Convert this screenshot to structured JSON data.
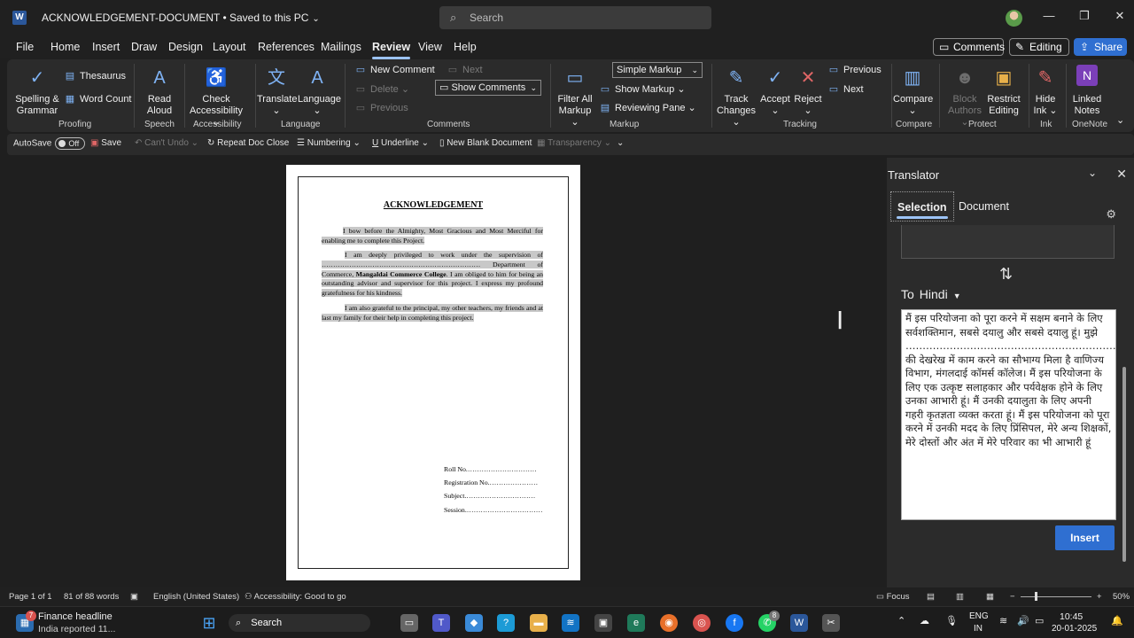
{
  "titlebar": {
    "doc_title": "ACKNOWLEDGEMENT-DOCUMENT • Saved to this PC",
    "search_placeholder": "Search"
  },
  "menu": [
    "File",
    "Home",
    "Insert",
    "Draw",
    "Design",
    "Layout",
    "References",
    "Mailings",
    "Review",
    "View",
    "Help"
  ],
  "menu_active": "Review",
  "top_buttons": {
    "comments": "Comments",
    "editing": "Editing",
    "share": "Share"
  },
  "ribbon": {
    "proofing": {
      "spelling": "Spelling & Grammar",
      "thesaurus": "Thesaurus",
      "word_count": "Word Count",
      "group": "Proofing"
    },
    "speech": {
      "read_aloud": "Read Aloud",
      "group": "Speech"
    },
    "accessibility": {
      "check": "Check Accessibility",
      "group": "Accessibility"
    },
    "language": {
      "translate": "Translate",
      "language": "Language",
      "group": "Language"
    },
    "comments": {
      "new": "New Comment",
      "delete": "Delete",
      "previous": "Previous",
      "next": "Next",
      "show": "Show Comments",
      "group": "Comments"
    },
    "markup": {
      "filter": "Filter All Markup",
      "simple": "Simple Markup",
      "show_markup": "Show Markup",
      "reviewing": "Reviewing Pane",
      "group": "Markup"
    },
    "tracking": {
      "track": "Track Changes",
      "accept": "Accept",
      "reject": "Reject",
      "previous": "Previous",
      "next": "Next",
      "group": "Tracking"
    },
    "compare": {
      "compare": "Compare",
      "group": "Compare"
    },
    "protect": {
      "block": "Block Authors",
      "restrict": "Restrict Editing",
      "group": "Protect"
    },
    "ink": {
      "hide": "Hide Ink",
      "group": "Ink"
    },
    "onenote": {
      "linked": "Linked Notes",
      "group": "OneNote"
    }
  },
  "qat": {
    "autosave": "AutoSave",
    "toggle": "Off",
    "save": "Save",
    "cant_undo": "Can't Undo",
    "repeat": "Repeat Doc Close",
    "numbering": "Numbering",
    "underline": "Underline",
    "new_blank": "New Blank Document",
    "transparency": "Transparency"
  },
  "document": {
    "heading": "ACKNOWLEDGEMENT",
    "p1": "I bow before the Almighty, Most Gracious and Most Merciful for enabling me to complete this Project.",
    "p2_a": "I am deeply privileged to work under the supervision of …………………………………………………………… Department of Commerce,",
    "p2_bold": "Mangaldai Commerce College",
    "p2_b": ". I am obliged to him for being an outstanding advisor and supervisor for this project. I express my profound gratefulness for his kindness.",
    "p3": "I am also grateful to the principal, my other teachers, my friends and at last my family for their help in completing this project.",
    "fields": [
      "Roll No.…………………………",
      "Registration No.…………………",
      "Subject.…………………………",
      "Session.……………………………"
    ]
  },
  "translator": {
    "title": "Translator",
    "tab_selection": "Selection",
    "tab_document": "Document",
    "to_label": "To",
    "to_lang": "Hindi",
    "translation": "मैं इस परियोजना को पूरा करने में सक्षम बनाने के लिए सर्वशक्तिमान, सबसे दयालु और सबसे दयालु हूं। मुझे ………………………………………………………… की देखरेख में काम करने का सौभाग्य मिला है वाणिज्य विभाग, मंगलदाई कॉमर्स कॉलेज। मैं इस परियोजना के लिए एक उत्कृष्ट सलाहकार और पर्यवेक्षक होने के लिए उनका आभारी हूं। मैं उनकी दयालुता के लिए अपनी गहरी कृतज्ञता व्यक्त करता हूं। मैं इस परियोजना को पूरा करने में उनकी मदद के लिए प्रिंसिपल, मेरे अन्य शिक्षकों, मेरे दोस्तों और अंत में मेरे परिवार का भी आभारी हूं",
    "insert": "Insert"
  },
  "statusbar": {
    "page": "Page 1 of 1",
    "words": "81 of 88 words",
    "lang": "English (United States)",
    "accessibility": "Accessibility: Good to go",
    "focus": "Focus",
    "zoom": "50%"
  },
  "taskbar": {
    "news_title": "Finance headline",
    "news_sub": "India reported 11...",
    "news_badge": "7",
    "search": "Search",
    "whatsapp_badge": "8",
    "lang_top": "ENG",
    "lang_bottom": "IN",
    "time": "10:45",
    "date": "20-01-2025"
  }
}
